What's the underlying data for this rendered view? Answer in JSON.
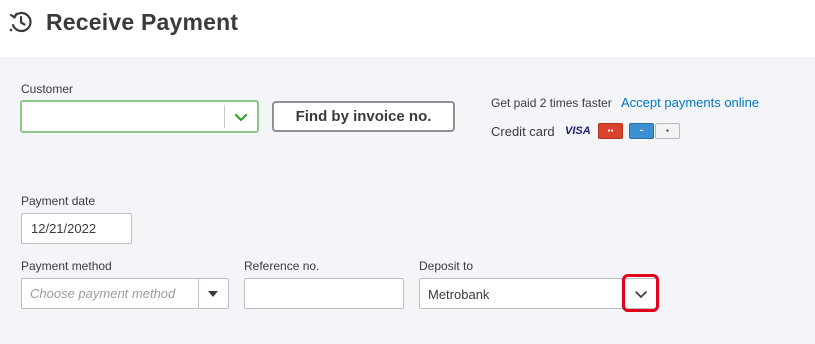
{
  "header": {
    "title": "Receive Payment",
    "icon": "history-clock-icon"
  },
  "customer": {
    "label": "Customer",
    "value": "",
    "accent_border": "#8dc78a",
    "chevron_color": "#2ca01c"
  },
  "find_invoice": {
    "label": "Find by invoice no."
  },
  "promo": {
    "text": "Get paid 2 times faster",
    "link": "Accept payments online",
    "link_color": "#0077c5",
    "credit_card_label": "Credit card",
    "cards": [
      "VISA",
      "MasterCard",
      "American Express",
      "DISCOVER"
    ],
    "visa_text": "VISA"
  },
  "payment_date": {
    "label": "Payment date",
    "value": "12/21/2022"
  },
  "payment_method": {
    "label": "Payment method",
    "placeholder": "Choose payment method",
    "value": ""
  },
  "reference": {
    "label": "Reference no.",
    "value": ""
  },
  "deposit_to": {
    "label": "Deposit to",
    "value": "Metrobank",
    "highlight_color": "#e3001b"
  }
}
